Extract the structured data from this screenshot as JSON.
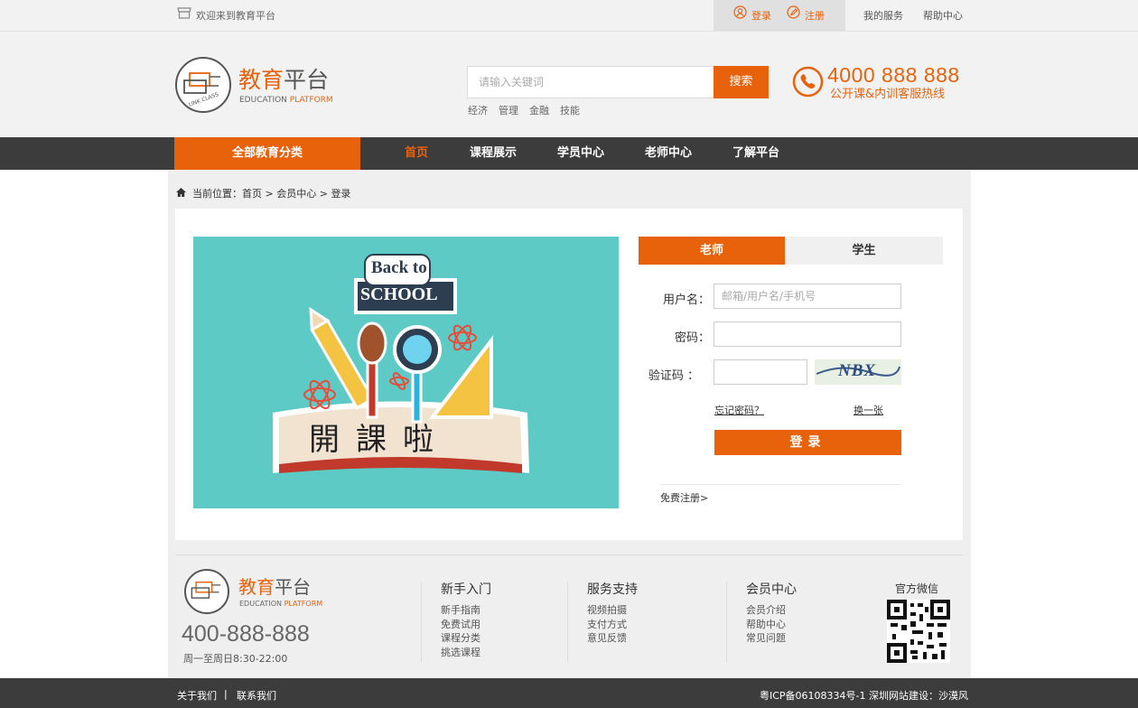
{
  "topbar": {
    "welcome": "欢迎来到教育平台",
    "login": "登录",
    "register": "注册",
    "my_service": "我的服务",
    "help_center": "帮助中心"
  },
  "header": {
    "logo_cn_part1": "教育",
    "logo_cn_part2": "平台",
    "logo_en_part1": "EDUCATION",
    "logo_en_part2": "PLATFORM",
    "logo_badge": "LINK CLASS",
    "search_placeholder": "请输入关键词",
    "search_button": "搜索",
    "hot_words": [
      "经济",
      "管理",
      "金融",
      "技能"
    ],
    "hotline_number": "4000 888 888",
    "hotline_desc": "公开课&内训客服热线"
  },
  "nav": {
    "all_categories": "全部教育分类",
    "items": [
      "首页",
      "课程展示",
      "学员中心",
      "老师中心",
      "了解平台"
    ],
    "active_index": 0
  },
  "breadcrumb": {
    "prefix": "当前位置：",
    "path": [
      "首页",
      "会员中心",
      "登录"
    ],
    "separator": ">"
  },
  "banner": {
    "sign_line1": "Back to",
    "sign_line2": "SCHOOL",
    "book_text": "開課啦"
  },
  "login": {
    "tabs": [
      "老师",
      "学生"
    ],
    "active_tab": 0,
    "username_label": "用户名：",
    "username_placeholder": "邮箱/用户名/手机号",
    "password_label": "密码：",
    "captcha_label": "验证码 ：",
    "captcha_image_text": "NBX",
    "forgot_password": "忘记密码？",
    "refresh_captcha": "换一张",
    "submit": "登录",
    "free_register": "免费注册>"
  },
  "footer": {
    "phone": "400-888-888",
    "hours": "周一至周日8:30-22:00",
    "columns": [
      {
        "title": "新手入门",
        "items": [
          "新手指南",
          "免费试用",
          "课程分类",
          "挑选课程"
        ]
      },
      {
        "title": "服务支持",
        "items": [
          "视频拍摄",
          "支付方式",
          "意见反馈"
        ]
      },
      {
        "title": "会员中心",
        "items": [
          "会员介绍",
          "帮助中心",
          "常见问题"
        ]
      }
    ],
    "wechat_title": "官方微信",
    "bottom_links": [
      "关于我们",
      "联系我们"
    ],
    "bottom_separator": "|",
    "icp": "粤ICP备06108334号-1",
    "builder": "深圳网站建设：沙漠风"
  },
  "colors": {
    "accent": "#e8620c",
    "nav_bg": "#3c3c3c",
    "banner_bg": "#5ecac5"
  }
}
